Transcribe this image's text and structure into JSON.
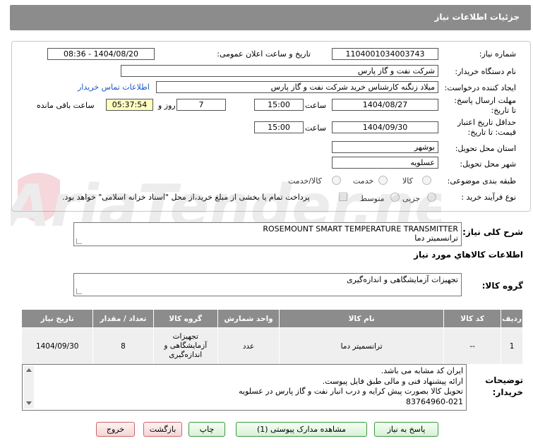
{
  "page_title": "جزئیات اطلاعات نیاز",
  "form": {
    "need_number_label": "شماره نیاز:",
    "need_number": "1104001034003743",
    "announce_label": "تاریخ و ساعت اعلان عمومی:",
    "announce_value": "1404/08/20 - 08:36",
    "buyer_org_label": "نام دستگاه خریدار:",
    "buyer_org": "شرکت نفت و گاز پارس",
    "creator_label": "ایجاد کننده درخواست:",
    "creator": "میلاد زنگنه کارشناس خرید شرکت نفت و گاز پارس",
    "contact_link": "اطلاعات تماس خریدار",
    "deadline_label": "مهلت ارسال پاسخ: تا تاریخ:",
    "deadline_date": "1404/08/27",
    "time_word": "ساعت",
    "deadline_time": "15:00",
    "days_value": "7",
    "days_and": "روز و",
    "remaining_time": "05:37:54",
    "remaining_label": "ساعت باقی مانده",
    "validity_label": "حداقل تاریخ اعتبار قیمت: تا تاریخ:",
    "validity_date": "1404/09/30",
    "validity_time": "15:00",
    "province_label": "استان محل تحویل:",
    "province": "بوشهر",
    "city_label": "شهر محل تحویل:",
    "city": "عسلویه",
    "category_label": "طبقه بندی موضوعی:",
    "category_options": [
      "کالا",
      "خدمت",
      "کالا/خدمت"
    ],
    "process_label": "نوع فرآیند خرید :",
    "process_options": [
      "جزیی",
      "متوسط"
    ],
    "payment_note": "پرداخت تمام یا بخشی از مبلغ خرید،از محل \"اسناد خزانه اسلامی\" خواهد بود."
  },
  "watermark_text": "AriaTender.net",
  "summary": {
    "label": "شرح کلی نیاز:",
    "line1": "ROSEMOUNT SMART TEMPERATURE TRANSMITTER",
    "line2": "ترانسمیتر دما"
  },
  "goods": {
    "section_title": "اطلاعات کالاهاي مورد نیاز",
    "group_label": "گروه کالا:",
    "group_value": "تجهیزات آزمایشگاهی و اندازه‌گیری"
  },
  "table": {
    "headers": [
      "ردیف",
      "کد کالا",
      "نام کالا",
      "واحد شمارش",
      "گروه کالا",
      "تعداد / مقدار",
      "تاریخ نیاز"
    ],
    "row": {
      "index": "1",
      "code": "--",
      "name": "ترانسمیتر دما",
      "unit": "عدد",
      "group": "تجهیزات آزمایشگاهی و اندازه‌گیری",
      "qty": "8",
      "date": "1404/09/30"
    }
  },
  "notes": {
    "label": "توضیحات خریدار:",
    "lines": [
      "ایران کد مشابه می باشد.",
      "ارائه پیشنهاد فنی و مالی طبق فایل پیوست.",
      "تحویل کالا بصورت پیش کرایه و درب انبار نفت و گاز پارس در عسلویه",
      "83764960-021"
    ]
  },
  "buttons": {
    "reply": "پاسخ به نیاز",
    "attachments": "مشاهده مدارک پیوستی (1)",
    "print": "چاپ",
    "back": "بازگشت",
    "exit": "خروج"
  }
}
